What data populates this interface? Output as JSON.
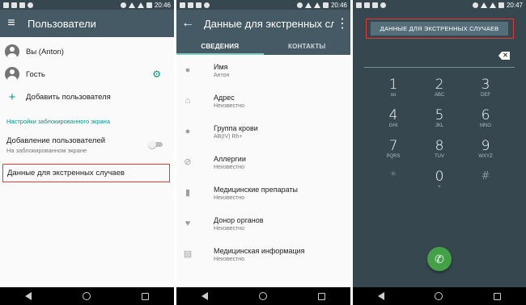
{
  "screen1": {
    "time": "20:46",
    "title": "Пользователи",
    "users": [
      {
        "label": "Вы (Anton)"
      },
      {
        "label": "Гость"
      }
    ],
    "add_user": "Добавить пользователя",
    "section_header": "Настройки заблокированного экрана",
    "toggle_title": "Добавление пользователей",
    "toggle_subtitle": "На заблокированном экране",
    "emergency": "Данные для экстренных случаев"
  },
  "screen2": {
    "time": "20:46",
    "title": "Данные для экстренных сл...",
    "tabs": [
      {
        "label": "СВЕДЕНИЯ"
      },
      {
        "label": "КОНТАКТЫ"
      }
    ],
    "rows": [
      {
        "icon": "person-icon",
        "label": "Имя",
        "value": "Антон"
      },
      {
        "icon": "home-icon",
        "label": "Адрес",
        "value": "Неизвестно"
      },
      {
        "icon": "drop-icon",
        "label": "Группа крови",
        "value": "AB(IV) Rh+"
      },
      {
        "icon": "block-icon",
        "label": "Аллергии",
        "value": "Неизвестно"
      },
      {
        "icon": "medication-icon",
        "label": "Медицинские препараты",
        "value": "Неизвестно"
      },
      {
        "icon": "heart-icon",
        "label": "Донор органов",
        "value": "Неизвестно"
      },
      {
        "icon": "clipboard-icon",
        "label": "Медицинская информация",
        "value": "Неизвестно"
      }
    ]
  },
  "screen3": {
    "time": "20:47",
    "emergency_button": "ДАННЫЕ ДЛЯ ЭКСТРЕННЫХ СЛУЧАЕВ",
    "keys": [
      {
        "digit": "1",
        "sub": "ᴏᴏ"
      },
      {
        "digit": "2",
        "sub": "ABC"
      },
      {
        "digit": "3",
        "sub": "DEF"
      },
      {
        "digit": "4",
        "sub": "GHI"
      },
      {
        "digit": "5",
        "sub": "JKL"
      },
      {
        "digit": "6",
        "sub": "MNO"
      },
      {
        "digit": "7",
        "sub": "PQRS"
      },
      {
        "digit": "8",
        "sub": "TUV"
      },
      {
        "digit": "9",
        "sub": "WXYZ"
      },
      {
        "digit": "*",
        "sub": ""
      },
      {
        "digit": "0",
        "sub": "+"
      },
      {
        "digit": "#",
        "sub": ""
      }
    ]
  },
  "colors": {
    "appbar": "#455a64",
    "accent": "#009688",
    "highlight": "#e53935",
    "dialer_bg": "#37474f",
    "call": "#43a047"
  }
}
